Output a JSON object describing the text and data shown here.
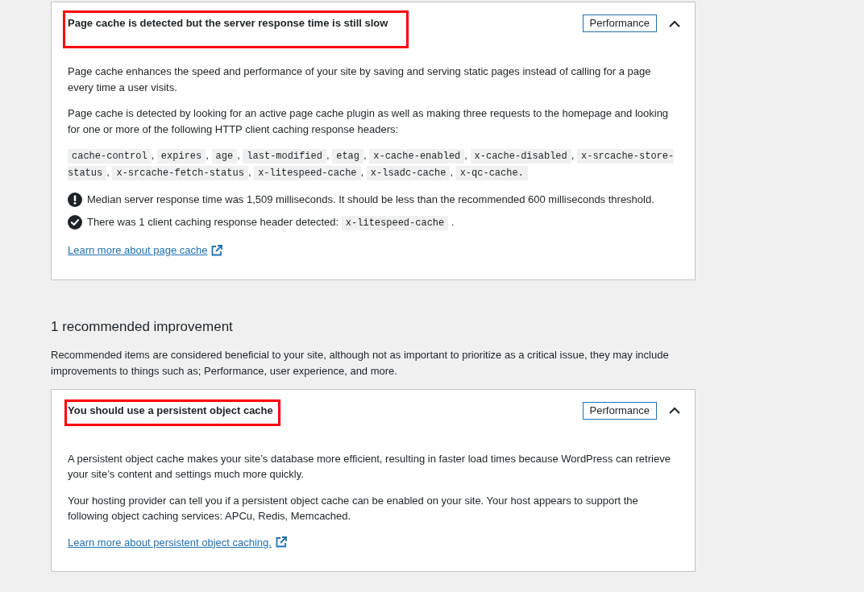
{
  "critical_issues": [
    {
      "title": "Page cache is detected but the server response time is still slow",
      "annotated": true,
      "badge": "Performance",
      "expanded": true,
      "paragraphs": [
        "Page cache enhances the speed and performance of your site by saving and serving static pages instead of calling for a page every time a user visits.",
        "Page cache is detected by looking for an active page cache plugin as well as making three requests to the homepage and looking for one or more of the following HTTP client caching response headers:"
      ],
      "headers": {
        "separator": ",",
        "items": [
          "cache-control",
          "expires",
          "age",
          "last-modified",
          "etag",
          "x-cache-enabled",
          "x-cache-disabled",
          "x-srcache-store-status",
          "x-srcache-fetch-status",
          "x-litespeed-cache",
          "x-lsadc-cache",
          "x-qc-cache."
        ]
      },
      "results": [
        {
          "kind": "fail",
          "text": "Median server response time was 1,509 milliseconds. It should be less than the recommended 600 milliseconds threshold."
        },
        {
          "kind": "pass",
          "text": "There was 1 client caching response header detected:",
          "code": "x-litespeed-cache",
          "end": "."
        }
      ],
      "link": "Learn more about page cache"
    }
  ],
  "recommended_section": {
    "heading": "1 recommended improvement",
    "description": "Recommended items are considered beneficial to your site, although not as important to prioritize as a critical issue, they may include improvements to things such as; Performance, user experience, and more.",
    "issues": [
      {
        "title": "You should use a persistent object cache",
        "annotated": true,
        "badge": "Performance",
        "expanded": true,
        "paragraphs": [
          "A persistent object cache makes your site’s database more efficient, resulting in faster load times because WordPress can retrieve your site’s content and settings much more quickly.",
          "Your hosting provider can tell you if a persistent object cache can be enabled on your site. Your host appears to support the following object caching services: APCu, Redis, Memcached."
        ],
        "link": "Learn more about persistent object caching."
      }
    ]
  }
}
